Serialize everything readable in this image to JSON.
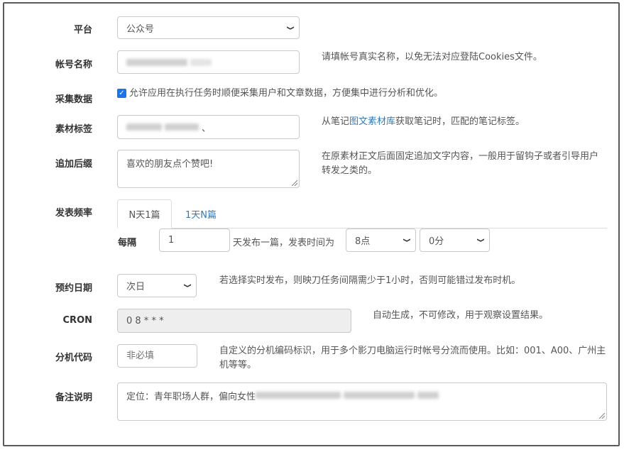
{
  "form": {
    "platform": {
      "label": "平台",
      "value": "公众号"
    },
    "account_name": {
      "label": "帐号名称",
      "help": "请填帐号真实名称，以免无法对应登陆Cookies文件。"
    },
    "collect": {
      "label": "采集数据",
      "checkbox_text": "允许应用在执行任务时顺便采集用户和文章数据，方便集中进行分析和优化。",
      "checked": true
    },
    "material_tag": {
      "label": "素材标签",
      "value_suffix": "、",
      "help_prefix": "从笔记",
      "help_link": "图文素材库",
      "help_suffix": "获取笔记时，匹配的笔记标签。"
    },
    "suffix": {
      "label": "追加后缀",
      "value": "喜欢的朋友点个赞吧!",
      "help": "在原素材正文后面固定追加文字内容，一般用于留钩子或者引导用户转发之类的。"
    },
    "frequency": {
      "label": "发表频率",
      "tabs": [
        {
          "label": "N天1篇",
          "active": true
        },
        {
          "label": "1天N篇",
          "active": false
        }
      ],
      "every_label": "每隔",
      "days_value": "1",
      "mid_text": "天发布一篇，发表时间为",
      "hour_value": "8点",
      "minute_value": "0分"
    },
    "schedule_date": {
      "label": "预约日期",
      "value": "次日",
      "help": "若选择实时发布，则映刀任务间隔需少于1小时，否则可能错过发布时机。"
    },
    "cron": {
      "label": "CRON",
      "value": "0 8 * * *",
      "help": "自动生成，不可修改，用于观察设置结果。"
    },
    "machine_code": {
      "label": "分机代码",
      "placeholder": "非必填",
      "help": "自定义的分机编码标识，用于多个影刀电脑运行时帐号分流而使用。比如：001、A00、广州主机等等。"
    },
    "remark": {
      "label": "备注说明",
      "value_prefix": "定位：青年职场人群，偏向女性"
    }
  }
}
